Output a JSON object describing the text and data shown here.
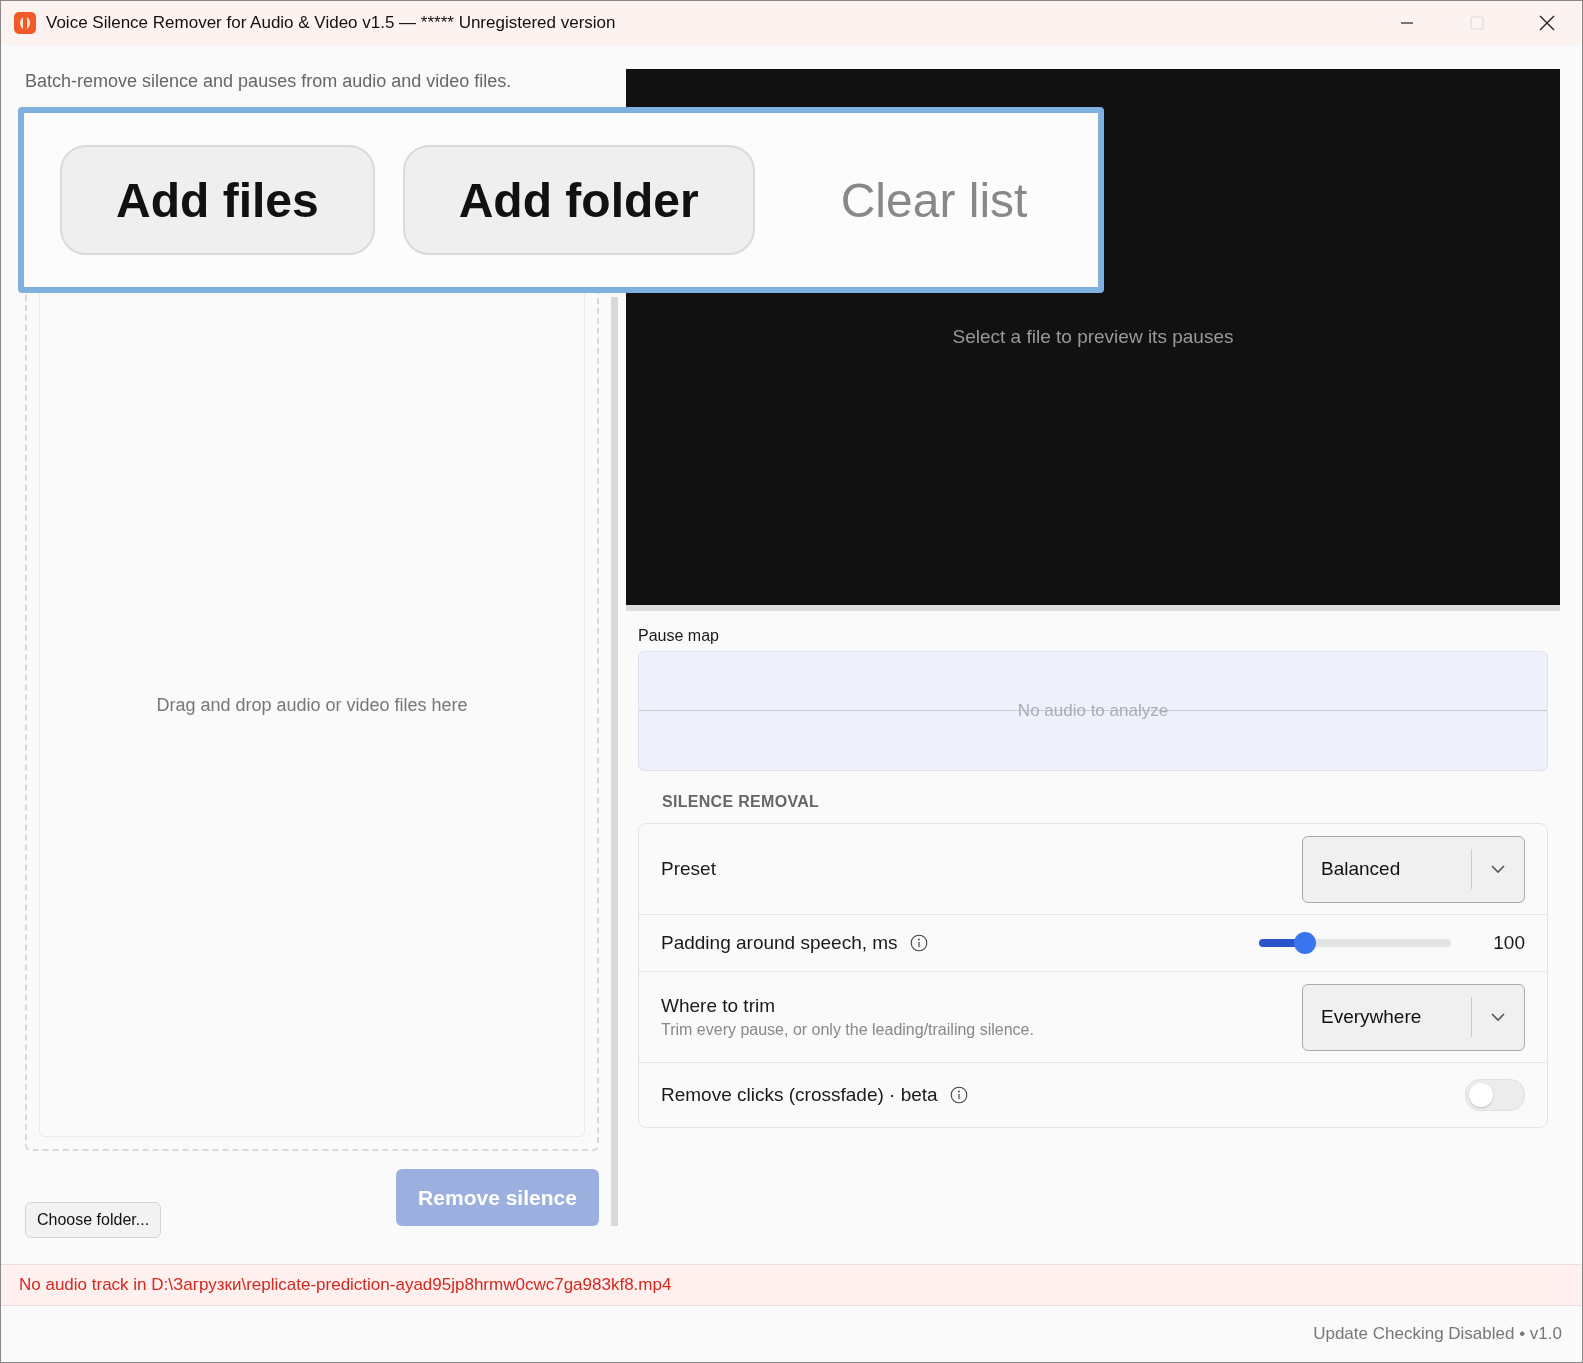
{
  "window": {
    "title": "Voice Silence Remover for Audio & Video v1.5 — ***** Unregistered version",
    "controls": [
      {
        "kind": "minimize",
        "disabled": false
      },
      {
        "kind": "maximize",
        "disabled": true
      },
      {
        "kind": "close",
        "disabled": false
      }
    ]
  },
  "subtitle": "Batch-remove silence and pauses from audio and video files.",
  "toolbar_zoom": {
    "buttons": [
      {
        "label": "Add files",
        "disabled": false
      },
      {
        "label": "Add folder",
        "disabled": false
      },
      {
        "label": "Clear list",
        "disabled": true
      }
    ]
  },
  "drop_zone": {
    "text": "Drag and drop audio or video files here"
  },
  "choose_folder": {
    "label": "Choose folder...",
    "disabled": false
  },
  "remove_silence": {
    "label": "Remove silence",
    "disabled": true
  },
  "preview": {
    "text": "Select a file to preview its pauses"
  },
  "pause_map": {
    "title": "Pause map",
    "text": "No audio to analyze"
  },
  "section_title": "SILENCE REMOVAL",
  "settings": [
    {
      "kind": "select",
      "label": "Preset",
      "value": "Balanced"
    },
    {
      "kind": "slider",
      "label": "Padding around speech, ms",
      "info": true,
      "level": 0.24,
      "reading": "100"
    },
    {
      "kind": "select",
      "label": "Where to trim",
      "hint": "Trim every pause, or only the leading/trailing silence.",
      "value": "Everywhere"
    },
    {
      "kind": "toggle",
      "label": "Remove clicks (crossfade) · beta",
      "info": true,
      "on": false
    }
  ],
  "error": "No audio track in D:\\Загрузки\\replicate-prediction-ayad95jp8hrmw0cwc7ga983kf8.mp4",
  "footer": "Update Checking Disabled • v1.0"
}
